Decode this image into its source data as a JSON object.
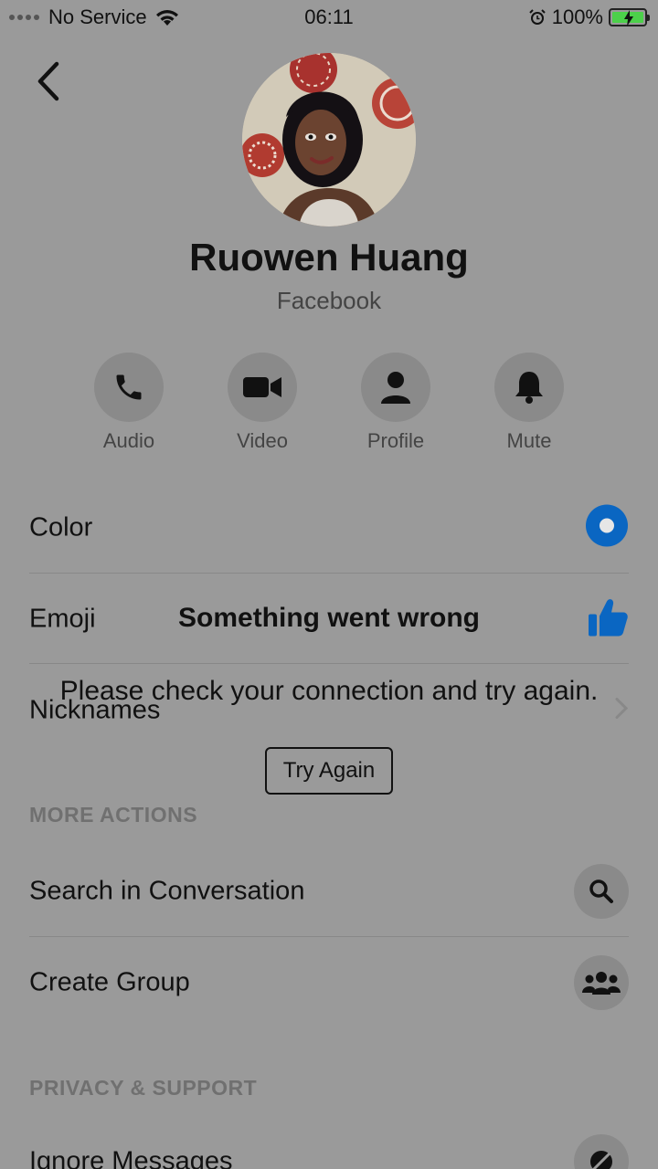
{
  "status_bar": {
    "carrier": "No Service",
    "time": "06:11",
    "battery": "100%"
  },
  "profile": {
    "name": "Ruowen Huang",
    "source": "Facebook"
  },
  "actions": [
    {
      "label": "Audio",
      "icon": "phone-icon"
    },
    {
      "label": "Video",
      "icon": "video-camera-icon"
    },
    {
      "label": "Profile",
      "icon": "person-icon"
    },
    {
      "label": "Mute",
      "icon": "bell-icon"
    }
  ],
  "settings": {
    "color_label": "Color",
    "emoji_label": "Emoji",
    "nicknames_label": "Nicknames"
  },
  "more_actions": {
    "header": "MORE ACTIONS",
    "search_label": "Search in Conversation",
    "create_group_label": "Create Group"
  },
  "privacy": {
    "header": "PRIVACY & SUPPORT",
    "ignore_label": "Ignore Messages"
  },
  "error": {
    "title": "Something went wrong",
    "message": "Please check your connection and try again.",
    "button": "Try Again"
  },
  "colors": {
    "accent": "#0a66c2",
    "background": "#9a9a9a"
  }
}
